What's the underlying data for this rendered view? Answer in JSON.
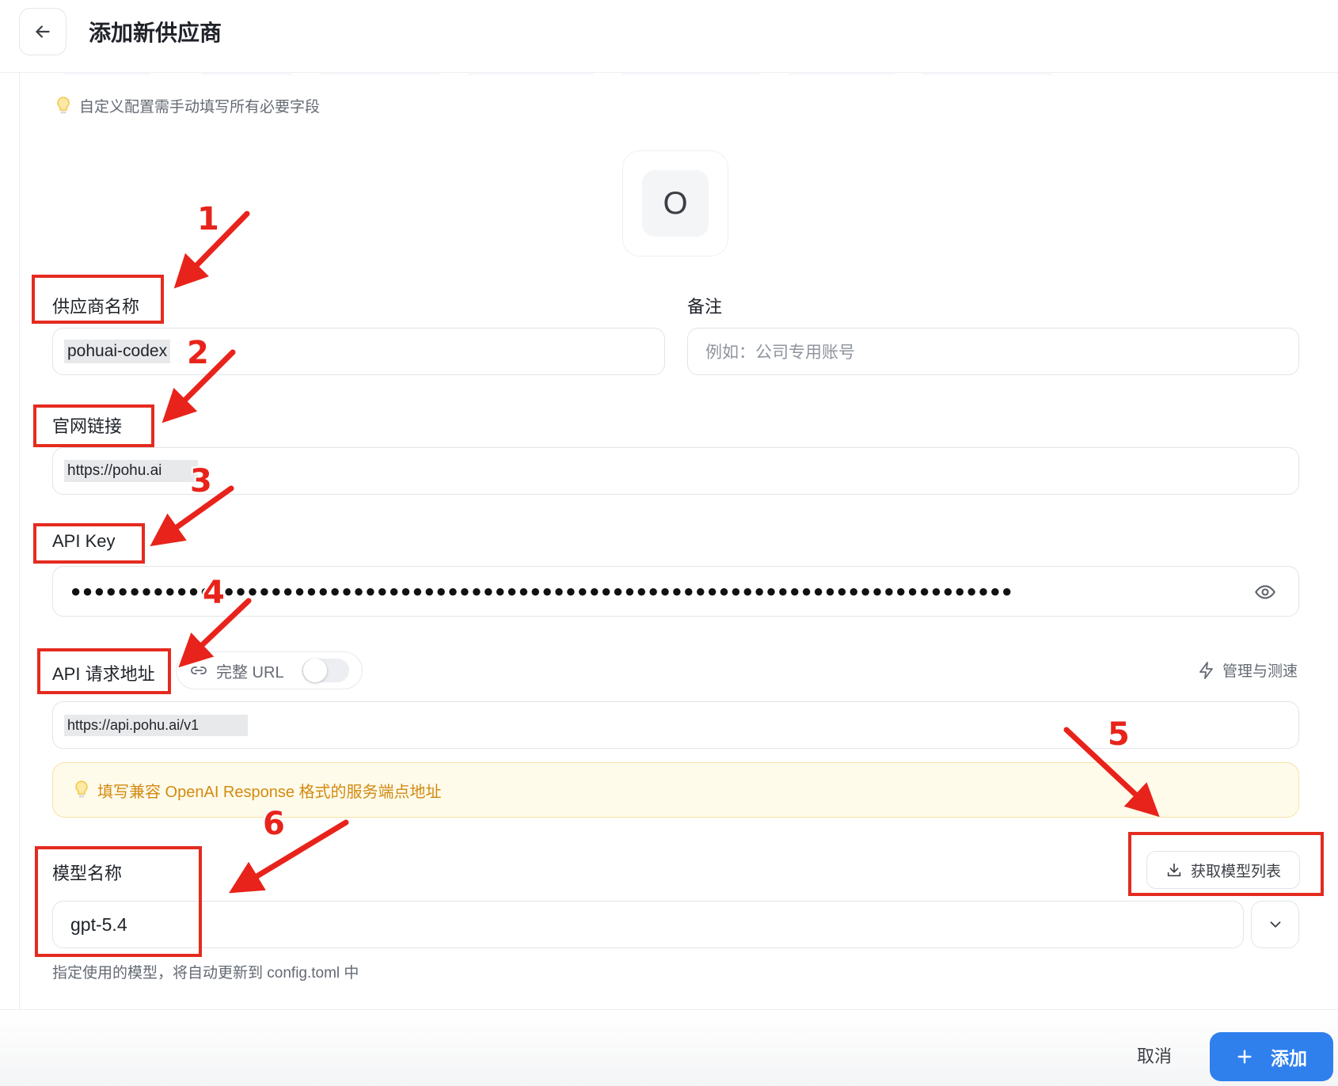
{
  "header": {
    "title": "添加新供应商"
  },
  "hint": {
    "text": "自定义配置需手动填写所有必要字段"
  },
  "provider_icon": {
    "letter": "O"
  },
  "form": {
    "name": {
      "label": "供应商名称",
      "value": "pohuai-codex"
    },
    "note": {
      "label": "备注",
      "placeholder": "例如：公司专用账号"
    },
    "website": {
      "label": "官网链接",
      "value": "https://pohu.ai"
    },
    "api_key": {
      "label": "API Key",
      "masked": "●●●●●●●●●●●●●●●●●●●●●●●●●●●●●●●●●●●●●●●●●●●●●●●●●●●●●●●●●●●●●●●●●●●●●●●●●●●●●●●●"
    },
    "endpoint": {
      "label": "API 请求地址",
      "full_url_label": "完整 URL",
      "full_url_enabled": false,
      "manage_label": "管理与测速",
      "value": "https://api.pohu.ai/v1",
      "notice": "填写兼容 OpenAI Response 格式的服务端点地址"
    },
    "model": {
      "label": "模型名称",
      "fetch_label": "获取模型列表",
      "value": "gpt-5.4",
      "helper": "指定使用的模型，将自动更新到 config.toml 中"
    }
  },
  "footer": {
    "cancel_label": "取消",
    "add_label": "添加"
  },
  "annotations": [
    "1",
    "2",
    "3",
    "4",
    "5",
    "6"
  ],
  "colors": {
    "accent": "#2f80ed",
    "annotation": "#e42b1f",
    "notice_text": "#d28a12",
    "notice_bg": "#fffbea"
  }
}
